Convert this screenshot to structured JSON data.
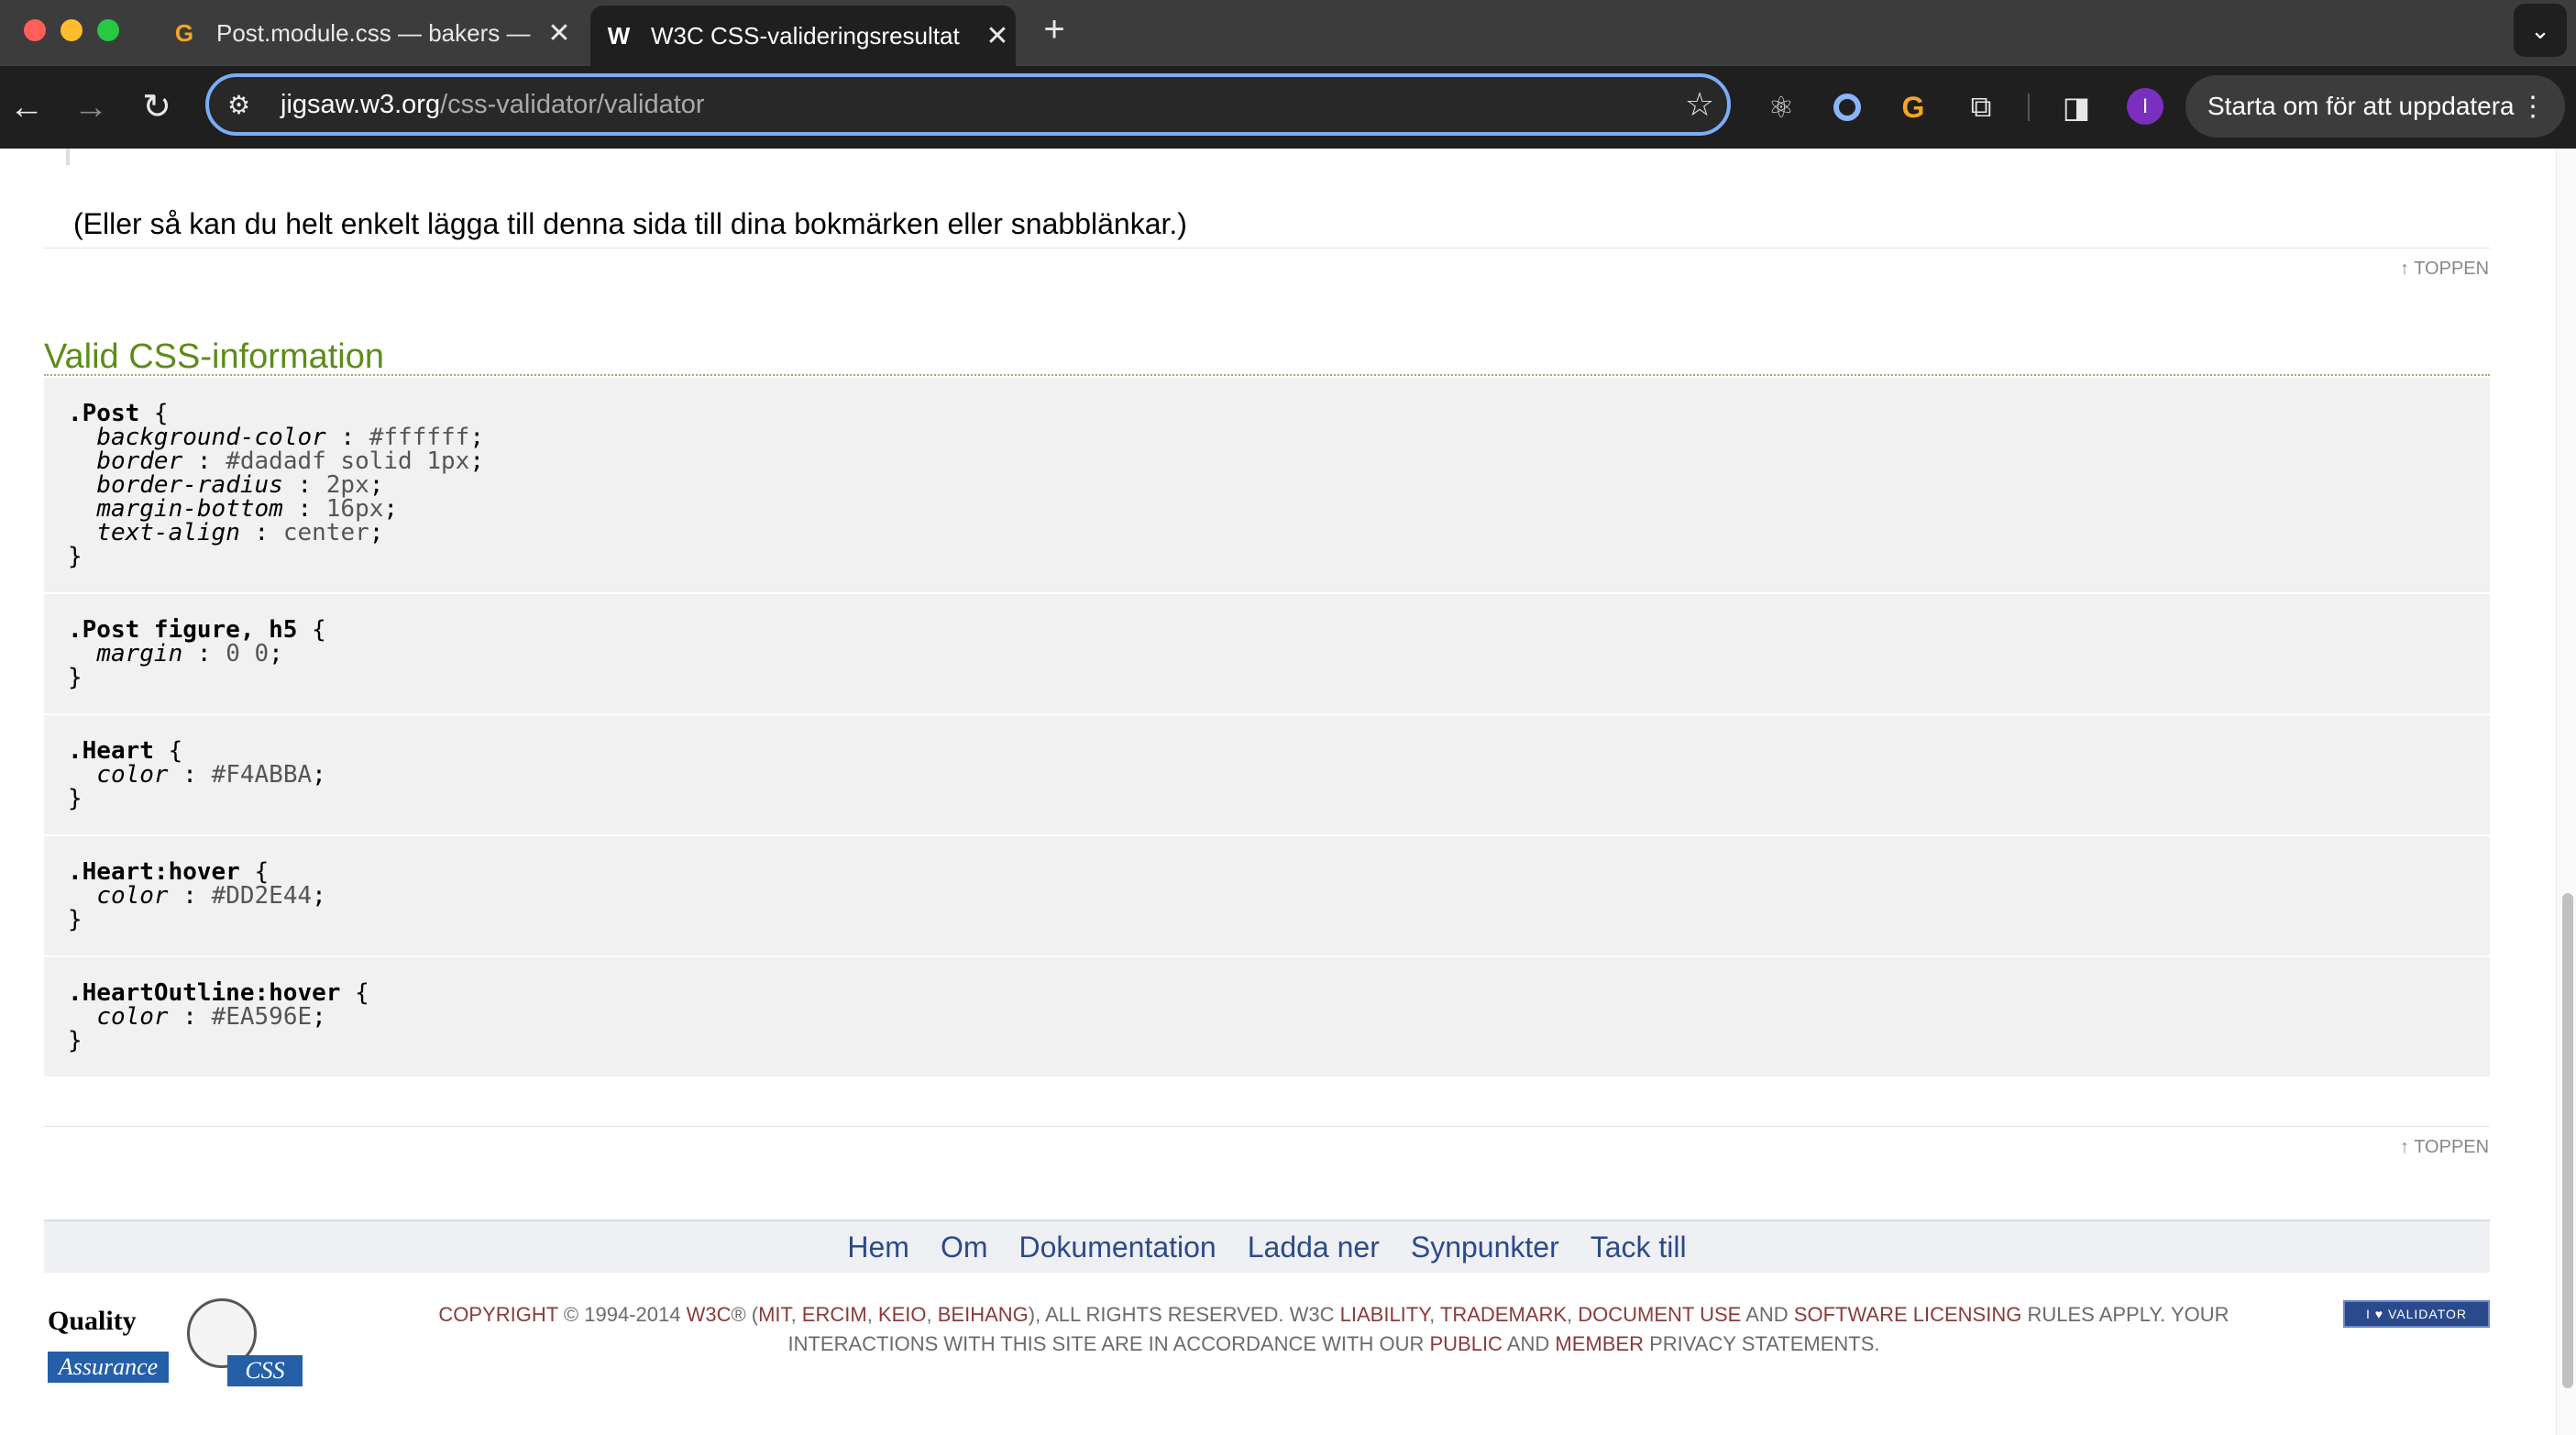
{
  "browser": {
    "tabs": [
      {
        "title": "Post.module.css — bakers — ",
        "favicon": "G",
        "active": false
      },
      {
        "title": "W3C CSS-valideringsresultat",
        "favicon": "W",
        "active": true
      }
    ],
    "new_tab_label": "+",
    "tab_menu_label": "⌄",
    "url_host": "jigsaw.w3.org",
    "url_path": "/css-validator/validator",
    "update_button_label": "Starta om för att uppdatera",
    "avatar_letter": "I"
  },
  "page": {
    "bookmark_text": "(Eller så kan du helt enkelt lägga till denna sida till dina bokmärken eller snabblänkar.)",
    "top_link_label": "↑ TOPPEN",
    "section_title": "Valid CSS-information",
    "css_rules": [
      {
        "selector": ".Post",
        "declarations": [
          {
            "prop": "background-color",
            "value": "#ffffff"
          },
          {
            "prop": "border",
            "value": "#dadadf solid 1px"
          },
          {
            "prop": "border-radius",
            "value": "2px"
          },
          {
            "prop": "margin-bottom",
            "value": "16px"
          },
          {
            "prop": "text-align",
            "value": "center"
          }
        ]
      },
      {
        "selector": ".Post figure, h5",
        "declarations": [
          {
            "prop": "margin",
            "value": "0 0"
          }
        ]
      },
      {
        "selector": ".Heart",
        "declarations": [
          {
            "prop": "color",
            "value": "#F4ABBA"
          }
        ]
      },
      {
        "selector": ".Heart:hover",
        "declarations": [
          {
            "prop": "color",
            "value": "#DD2E44"
          }
        ]
      },
      {
        "selector": ".HeartOutline:hover",
        "declarations": [
          {
            "prop": "color",
            "value": "#EA596E"
          }
        ]
      }
    ],
    "footer_nav": [
      "Hem",
      "Om",
      "Dokumentation",
      "Ladda ner",
      "Synpunkter",
      "Tack till"
    ],
    "qa_logo_text": {
      "top": "Quality",
      "bottom": "Assurance"
    },
    "css_logo_text": "CSS",
    "copyright": {
      "parts": [
        {
          "t": "Copyright",
          "link": true
        },
        {
          "t": " © 1994-2014 ",
          "link": false
        },
        {
          "t": "W3C",
          "link": true
        },
        {
          "t": "® (",
          "link": false
        },
        {
          "t": "MIT",
          "link": true
        },
        {
          "t": ", ",
          "link": false
        },
        {
          "t": "ERCIM",
          "link": true
        },
        {
          "t": ", ",
          "link": false
        },
        {
          "t": "Keio",
          "link": true
        },
        {
          "t": ", ",
          "link": false
        },
        {
          "t": "Beihang",
          "link": true
        },
        {
          "t": "), All Rights Reserved. W3C ",
          "link": false
        },
        {
          "t": "liability",
          "link": true
        },
        {
          "t": ", ",
          "link": false
        },
        {
          "t": "trademark",
          "link": true
        },
        {
          "t": ", ",
          "link": false
        },
        {
          "t": "document use",
          "link": true
        },
        {
          "t": " and ",
          "link": false
        },
        {
          "t": "software licensing",
          "link": true
        },
        {
          "t": " rules apply. Your interactions with this site are in accordance with our ",
          "link": false
        },
        {
          "t": "public",
          "link": true
        },
        {
          "t": " and ",
          "link": false
        },
        {
          "t": "Member",
          "link": true
        },
        {
          "t": " privacy statements.",
          "link": false
        }
      ]
    },
    "validator_badge_label": "I ♥ VALIDATOR"
  },
  "colors": {
    "section_title": "#5d8c18",
    "footer_link": "#2b4a8c",
    "copyright_link": "#8b3a3a",
    "omnibox_focus": "#7cacf8"
  }
}
